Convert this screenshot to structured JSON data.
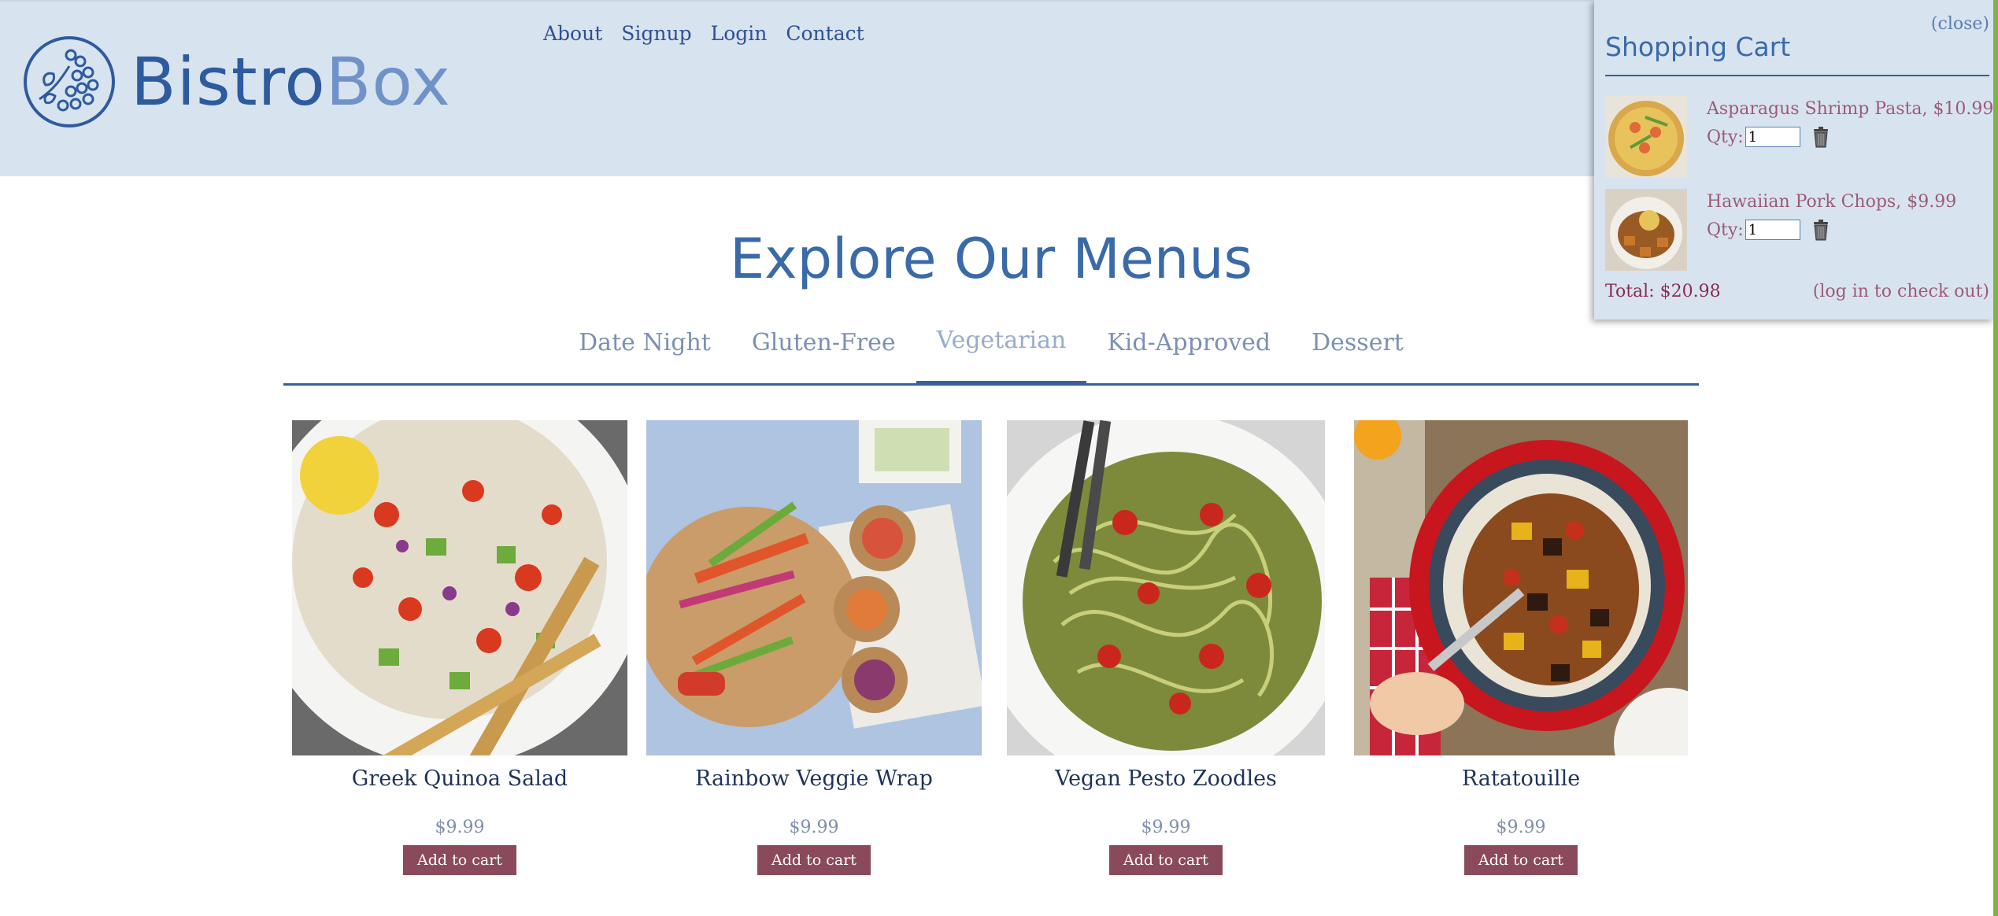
{
  "logo": {
    "part1": "Bistro",
    "part2": "Box"
  },
  "nav": {
    "items": [
      "About",
      "Signup",
      "Login",
      "Contact"
    ]
  },
  "main": {
    "title": "Explore Our Menus",
    "tabs": [
      {
        "label": "Date Night",
        "active": false
      },
      {
        "label": "Gluten-Free",
        "active": false
      },
      {
        "label": "Vegetarian",
        "active": true
      },
      {
        "label": "Kid-Approved",
        "active": false
      },
      {
        "label": "Dessert",
        "active": false
      }
    ],
    "cards": [
      {
        "name": "Greek Quinoa Salad",
        "price": "$9.99",
        "button": "Add to cart"
      },
      {
        "name": "Rainbow Veggie Wrap",
        "price": "$9.99",
        "button": "Add to cart"
      },
      {
        "name": "Vegan Pesto Zoodles",
        "price": "$9.99",
        "button": "Add to cart"
      },
      {
        "name": "Ratatouille",
        "price": "$9.99",
        "button": "Add to cart"
      }
    ]
  },
  "cart": {
    "close_label": "(close)",
    "title": "Shopping Cart",
    "qty_label": "Qty:",
    "items": [
      {
        "name": "Asparagus Shrimp Pasta, $10.99",
        "qty": "1"
      },
      {
        "name": "Hawaiian Pork Chops, $9.99",
        "qty": "1"
      }
    ],
    "total": "Total: $20.98",
    "checkout_label": "(log in to check out)"
  },
  "colors": {
    "header_bg": "#d8e3f0",
    "accent_blue": "#3a6aa8",
    "button_maroon": "#8a4a5c",
    "cart_text": "#9c5b76"
  },
  "icons": [
    "bistrobox-logo-icon",
    "trash-icon"
  ]
}
